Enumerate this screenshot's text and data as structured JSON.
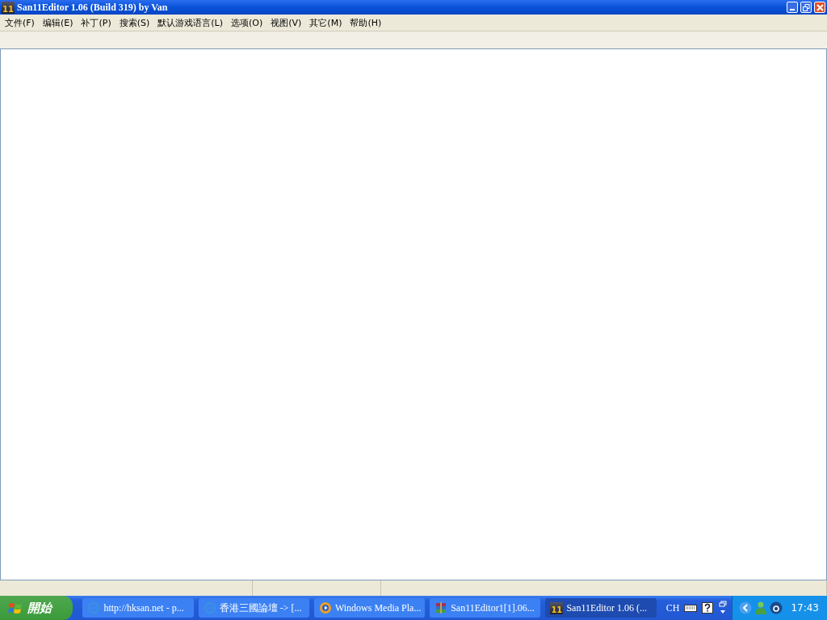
{
  "window": {
    "title": "San11Editor 1.06 (Build 319) by Van",
    "icon_text": "11"
  },
  "menu": [
    "文件(F)",
    "编辑(E)",
    "补丁(P)",
    "搜索(S)",
    "默认游戏语言(L)",
    "选项(O)",
    "视图(V)",
    "其它(M)",
    "帮助(H)"
  ],
  "taskbar": {
    "start": "開始",
    "buttons": [
      {
        "label": "http://hksan.net - p...",
        "kind": "ie",
        "selected": false
      },
      {
        "label": "香港三國論壇 -> [...",
        "kind": "ie",
        "selected": false
      },
      {
        "label": "Windows Media Pla...",
        "kind": "media",
        "selected": false
      },
      {
        "label": "San11Editor1[1].06...",
        "kind": "archive",
        "selected": false
      },
      {
        "label": "San11Editor 1.06 (...",
        "kind": "app",
        "icon_text": "11",
        "selected": true
      }
    ],
    "language": "CH",
    "clock": "17:43"
  }
}
